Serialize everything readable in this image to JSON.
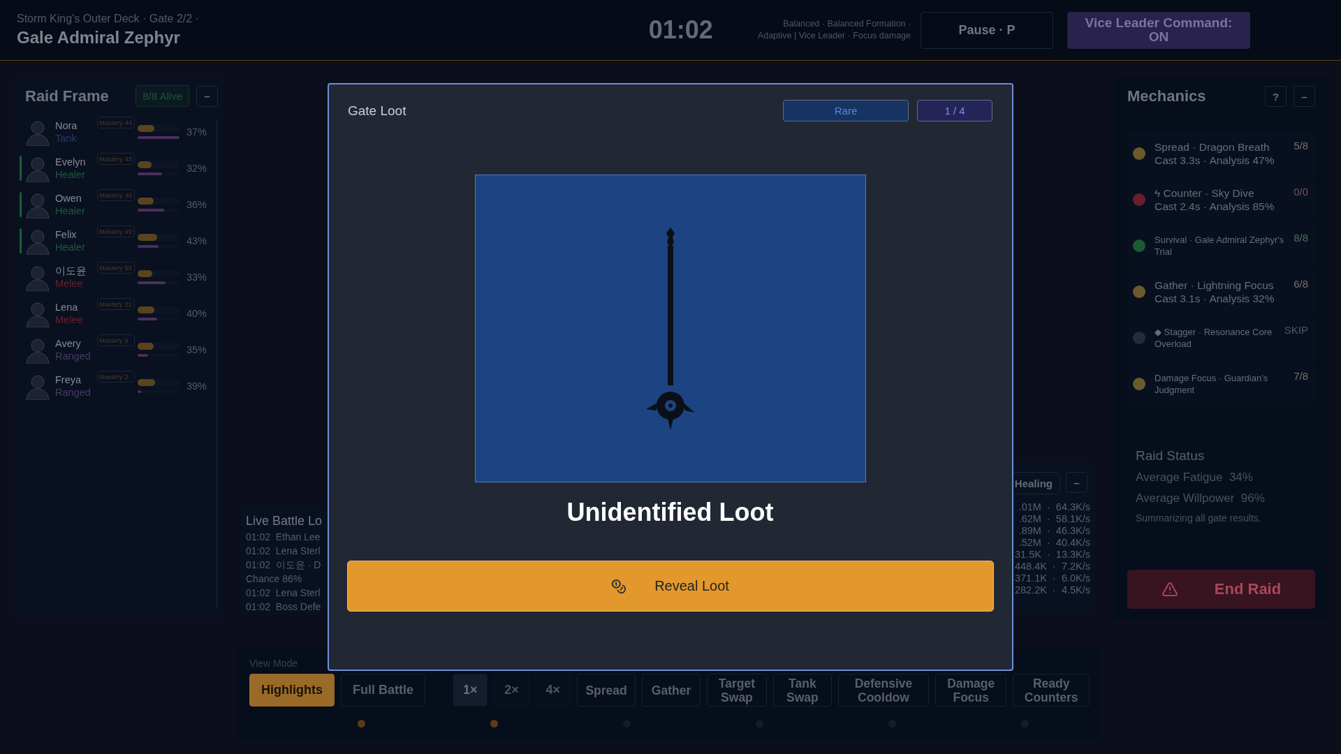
{
  "header": {
    "subtitle": "Storm King's Outer Deck · Gate 2/2 ·",
    "title": "Gale Admiral Zephyr",
    "timer": "01:02",
    "tactics": [
      "Balanced · Balanced Formation ·",
      "Adaptive | Vice Leader · Focus damage"
    ],
    "pause_button": "Pause · P",
    "command_button": {
      "label": "Vice Leader Command: ON",
      "on": true
    }
  },
  "raid_frame": {
    "title": "Raid Frame",
    "alive": "8/8 Alive",
    "collapse": "–",
    "members": [
      {
        "name": "Nora",
        "role": "Tank",
        "color": "#223a6a",
        "highlighted": false,
        "mastery": "Mastery 44",
        "stamina": {
          "level": 0.4
        },
        "willpower": {
          "level": 1.0
        },
        "percent": "37%"
      },
      {
        "name": "Evelyn",
        "role": "Healer",
        "color": "#1d5a3c",
        "highlighted": true,
        "mastery": "Mastery 43",
        "stamina": {
          "level": 0.33
        },
        "willpower": {
          "level": 0.58
        },
        "percent": "32%"
      },
      {
        "name": "Owen",
        "role": "Healer",
        "color": "#1d5a3c",
        "highlighted": true,
        "mastery": "Mastery 46",
        "stamina": {
          "level": 0.38
        },
        "willpower": {
          "level": 0.63
        },
        "percent": "36%"
      },
      {
        "name": "Felix",
        "role": "Healer",
        "color": "#1d5a3c",
        "highlighted": true,
        "mastery": "Mastery 49",
        "stamina": {
          "level": 0.46
        },
        "willpower": {
          "level": 0.5
        },
        "percent": "43%"
      },
      {
        "name": "이도윤",
        "role": "Melee",
        "color": "#6a2230",
        "highlighted": false,
        "mastery": "Mastery 55",
        "stamina": {
          "level": 0.35
        },
        "willpower": {
          "level": 0.67
        },
        "percent": "33%"
      },
      {
        "name": "Lena",
        "role": "Melee",
        "color": "#6a2230",
        "highlighted": false,
        "mastery": "Mastery 22",
        "stamina": {
          "level": 0.4
        },
        "willpower": {
          "level": 0.47
        },
        "percent": "40%"
      },
      {
        "name": "Avery",
        "role": "Ranged",
        "color": "#4a3a6a",
        "highlighted": false,
        "mastery": "Mastery 9",
        "stamina": {
          "level": 0.38
        },
        "willpower": {
          "level": 0.25
        },
        "percent": "35%"
      },
      {
        "name": "Freya",
        "role": "Ranged",
        "color": "#4a3a6a",
        "highlighted": false,
        "mastery": "Mastery 2",
        "stamina": {
          "level": 0.41
        },
        "willpower": {
          "level": 0.08
        },
        "percent": "39%"
      }
    ]
  },
  "battle_log": {
    "title": "Live Battle Lo",
    "entries": [
      "01:02  Ethan Lee",
      "01:02  Lena Sterl",
      "01:02  이도윤 · D",
      "Chance 86%",
      "01:02  Lena Sterl",
      "01:02  Boss Defe"
    ]
  },
  "meter": {
    "tab": "Healing",
    "collapse": "–",
    "rows": [
      ".01M  ·  64.3K/s",
      ".62M  ·  58.1K/s",
      ".89M  ·  46.3K/s",
      ".52M  ·  40.4K/s",
      "31.5K  ·  13.3K/s",
      "448.4K  ·  7.2K/s",
      "371.1K  ·  6.0K/s",
      "282.2K  ·  4.5K/s"
    ]
  },
  "view_mode": {
    "label": "View Mode",
    "modes": [
      {
        "label": "Highlights",
        "selected": true
      },
      {
        "label": "Full Battle",
        "selected": false
      }
    ],
    "speeds": [
      {
        "label": "1×",
        "selected": true
      },
      {
        "label": "2×",
        "selected": false
      },
      {
        "label": "4×",
        "selected": false
      }
    ],
    "filters": [
      "Spread",
      "Gather",
      "Target Swap",
      "Tank Swap",
      "Defensive Cooldow",
      "Damage Focus",
      "Ready Counters"
    ],
    "markers": [
      {
        "color": "#5a3a18"
      },
      {
        "color": "#5a3a18"
      },
      {
        "color": "#141c2a"
      },
      {
        "color": "#141c2a"
      },
      {
        "color": "#141c2a"
      },
      {
        "color": "#141c2a"
      }
    ]
  },
  "mechanics": {
    "title": "Mechanics",
    "help": "?",
    "collapse": "–",
    "items": [
      {
        "kind": "cast",
        "name": "Spread · Dragon Breath",
        "detail": "Cast 3.3s · Analysis 47%",
        "count": "5/8",
        "color": "#6b5a2e"
      },
      {
        "kind": "cast",
        "name": "ϟ Counter · Sky Dive",
        "detail": "Cast 2.4s · Analysis 85%",
        "count": "0/0",
        "color": "#6b1e2c"
      },
      {
        "kind": "note",
        "name": "Survival · Gale Admiral Zephyr's Trial",
        "count": "8/8",
        "color": "#1c5a33"
      },
      {
        "kind": "cast",
        "name": "Gather · Lightning Focus",
        "detail": "Cast 3.1s · Analysis 32%",
        "count": "6/8",
        "color": "#6b5a2e"
      },
      {
        "kind": "note",
        "name": "◆ Stagger · Resonance Core Overload",
        "count": "SKIP",
        "color": "#262a40"
      },
      {
        "kind": "note",
        "name": "Damage Focus · Guardian's Judgment",
        "count": "7/8",
        "color": "#6b5a2e"
      }
    ]
  },
  "raid_status": {
    "title": "Raid Status",
    "stats": [
      "Average Fatigue  34%",
      "Average Willpower  96%"
    ],
    "note": "Summarizing all gate results.",
    "end_button": "End Raid"
  },
  "modal": {
    "title": "Gate Loot",
    "rarity": "Rare",
    "page": "1 / 4",
    "item_name": "Unidentified Loot",
    "reveal_button": "Reveal Loot"
  }
}
